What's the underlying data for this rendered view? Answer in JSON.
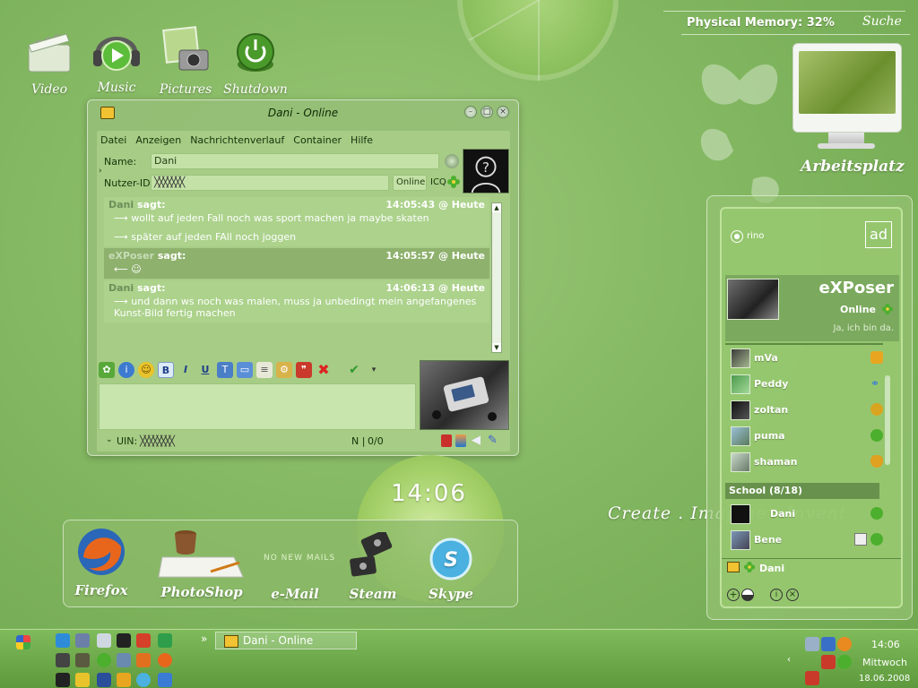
{
  "desktop": {
    "icons": [
      {
        "label": "Video"
      },
      {
        "label": "Music"
      },
      {
        "label": "Pictures"
      },
      {
        "label": "Shutdown"
      }
    ],
    "memory": "Physical Memory: 32%",
    "search": "Suche",
    "computer_label": "Arbeitsplatz",
    "clock": "14:06",
    "slogan": "Create . Imagine . Invent"
  },
  "chat_window": {
    "title": "Dani - Online",
    "menu": [
      "Datei",
      "Anzeigen",
      "Nachrichtenverlauf",
      "Container",
      "Hilfe"
    ],
    "name_label": "Name:",
    "name_value": "Dani",
    "uid_label": "Nutzer-ID:",
    "uid_value": "╳╳╳╳╳╳╳",
    "status": "Online",
    "protocol": "ICQ",
    "messages": [
      {
        "sender": "Dani",
        "verb": "sagt:",
        "time": "14:05:43 @ Heute",
        "lines": [
          "⟶ wollt auf jeden Fall noch was sport machen ja maybe skaten",
          "⟶ später auf jeden FAll noch joggen"
        ]
      },
      {
        "sender": "eXPoser",
        "verb": "sagt:",
        "time": "14:05:57 @ Heute",
        "lines": [
          "⟵ ☺"
        ]
      },
      {
        "sender": "Dani",
        "verb": "sagt:",
        "time": "14:06:13 @ Heute",
        "lines": [
          "⟶ und dann ws noch was malen, muss ja unbedingt mein angefangenes Kunst-Bild fertig machen"
        ]
      }
    ],
    "uin_label": "UIN:",
    "uin_value": "╳╳╳╳╳╳╳╳",
    "counter_mode": "N |",
    "counter": "0/0",
    "colors": {
      "accent": "#a8cd87",
      "window": "#96be78"
    }
  },
  "dock": {
    "items": [
      {
        "label": "Firefox"
      },
      {
        "label": "PhotoShop"
      },
      {
        "label": "e-Mail"
      },
      {
        "label": "Steam"
      },
      {
        "label": "Skype"
      }
    ],
    "mail_note": "NO NEW MAILS"
  },
  "contact_list": {
    "account": "rino",
    "user": {
      "name": "eXPoser",
      "status": "Online",
      "message": "Ja, ich bin da."
    },
    "contacts": [
      {
        "name": "mVa"
      },
      {
        "name": "Peddy"
      },
      {
        "name": "zoltan"
      },
      {
        "name": "puma"
      },
      {
        "name": "shaman"
      }
    ],
    "group": "School  (8/18)",
    "group_contacts": [
      {
        "name": "Dani"
      },
      {
        "name": "Bene"
      }
    ],
    "footer_user": "Dani"
  },
  "taskbar": {
    "task": "Dani - Online",
    "overflow": "»",
    "time": "14:06",
    "day": "Mittwoch",
    "date": "18.06.2008"
  }
}
